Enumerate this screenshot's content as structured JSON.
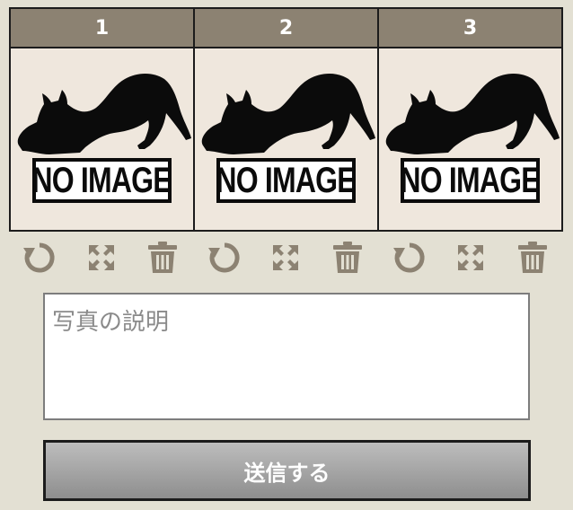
{
  "slots": [
    {
      "number": "1",
      "placeholder_text": "NO IMAGE"
    },
    {
      "number": "2",
      "placeholder_text": "NO IMAGE"
    },
    {
      "number": "3",
      "placeholder_text": "NO IMAGE"
    }
  ],
  "tools": {
    "icons": [
      "rotate-icon",
      "expand-icon",
      "trash-icon"
    ]
  },
  "description": {
    "placeholder": "写真の説明",
    "value": ""
  },
  "submit": {
    "label": "送信する"
  },
  "colors": {
    "background": "#e3e0d3",
    "slot_header": "#8c8272",
    "slot_body": "#efe7dd",
    "icon": "#8c8272"
  }
}
